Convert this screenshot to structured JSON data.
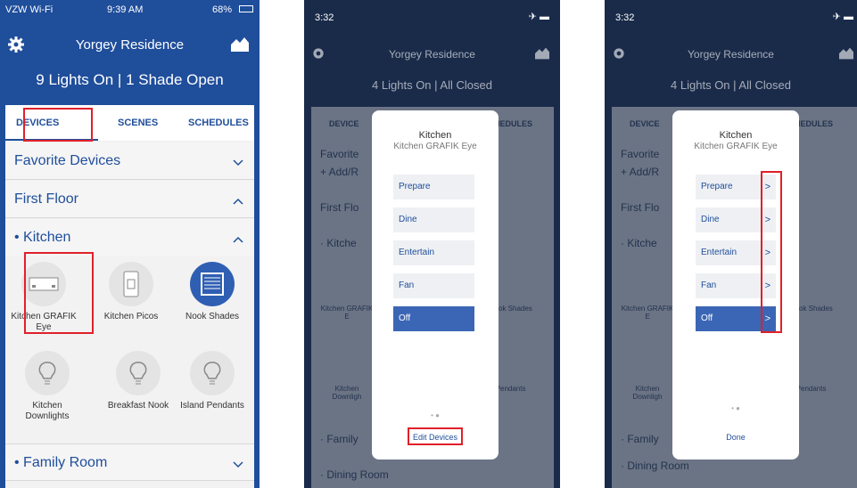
{
  "screen1": {
    "status": {
      "carrier": "VZW Wi-Fi",
      "time": "9:39 AM",
      "battery": "68%"
    },
    "title": "Yorgey Residence",
    "summary": "9 Lights On | 1 Shade Open",
    "tabs": [
      "DEVICES",
      "SCENES",
      "SCHEDULES"
    ],
    "sections": {
      "favorite": "Favorite Devices",
      "first_floor": "First Floor",
      "kitchen": "• Kitchen",
      "family_room": "• Family Room"
    },
    "devices": [
      {
        "name": "Kitchen GRAFIK Eye",
        "icon": "keypad-icon"
      },
      {
        "name": "Kitchen Picos",
        "icon": "pico-remote-icon"
      },
      {
        "name": "Nook Shades",
        "icon": "shade-icon"
      },
      {
        "name": "Kitchen Downlights",
        "icon": "bulb-icon"
      },
      {
        "name": "Breakfast Nook",
        "icon": "bulb-icon"
      },
      {
        "name": "Island Pendants",
        "icon": "bulb-icon"
      }
    ],
    "colors": {
      "brand": "#1f4e9b",
      "highlight": "#e0202a",
      "active_device": "#2f5fb3"
    }
  },
  "screen2": {
    "status": {
      "time": "3:32"
    },
    "title": "Yorgey Residence",
    "summary": "4 Lights On | All Closed",
    "modal": {
      "title": "Kitchen",
      "subtitle": "Kitchen GRAFIK Eye",
      "scenes": [
        "Prepare",
        "Dine",
        "Entertain",
        "Fan",
        "Off"
      ],
      "selected": "Off",
      "footer": "Edit Devices"
    },
    "background_rows": [
      "Favorite",
      "+ Add/R",
      "First Flo",
      "· Kitche",
      "· Family",
      "· Dining Room"
    ],
    "background_labels": {
      "tab_left": "DEVICE",
      "tab_right": "HEDULES",
      "shades": "ok Shades",
      "kitchen": "Kitchen GRAFIK E",
      "downlights": "Kitchen Downligh",
      "pendants": "d Pendants"
    }
  },
  "screen3": {
    "status": {
      "time": "3:32"
    },
    "title": "Yorgey Residence",
    "summary": "4 Lights On | All Closed",
    "modal": {
      "title": "Kitchen",
      "subtitle": "Kitchen GRAFIK Eye",
      "scenes": [
        "Prepare",
        "Dine",
        "Entertain",
        "Fan",
        "Off"
      ],
      "selected": "Off",
      "footer": "Done"
    },
    "background_rows": [
      "Favorite",
      "+ Add/R",
      "First Flo",
      "· Kitche",
      "· Family",
      "· Dining Room"
    ],
    "background_labels": {
      "tab_left": "DEVICE",
      "tab_right": "HEDULES",
      "shades": "ok Shades",
      "kitchen": "Kitchen GRAFIK E",
      "downlights": "Kitchen Downligh",
      "pendants": "d Pendants"
    }
  }
}
